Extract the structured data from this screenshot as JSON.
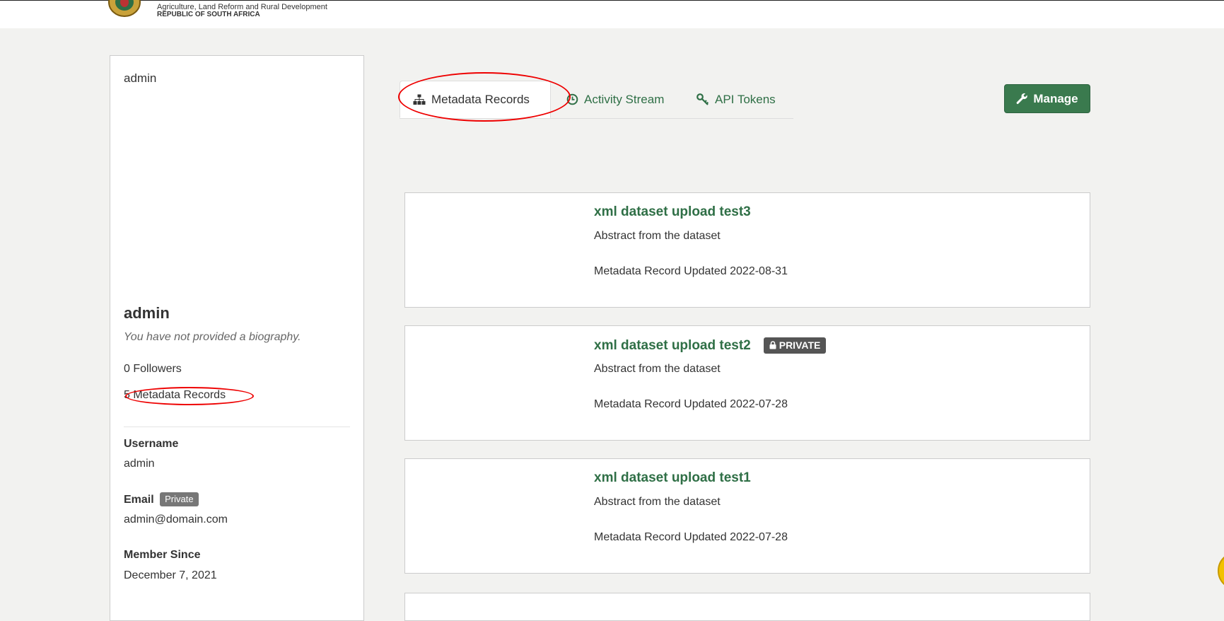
{
  "header": {
    "dept_line1": "Agriculture, Land Reform and Rural Development",
    "dept_line2": "REPUBLIC OF SOUTH AFRICA"
  },
  "sidebar": {
    "top_name": "admin",
    "heading": "admin",
    "bio": "You have not provided a biography.",
    "followers": "0 Followers",
    "records_count": "5 Metadata Records",
    "username_label": "Username",
    "username_value": "admin",
    "email_label": "Email",
    "email_badge": "Private",
    "email_value": "admin@domain.com",
    "member_since_label": "Member Since",
    "member_since_value": "December 7, 2021"
  },
  "tabs": [
    {
      "label": "Metadata Records",
      "icon": "sitemap-icon",
      "active": true
    },
    {
      "label": "Activity Stream",
      "icon": "clock-icon",
      "active": false
    },
    {
      "label": "API Tokens",
      "icon": "key-icon",
      "active": false
    }
  ],
  "manage_button": {
    "label": "Manage",
    "icon": "wrench-icon"
  },
  "datasets": [
    {
      "title": "xml dataset upload test3",
      "private": false,
      "abstract": "Abstract from the dataset",
      "updated": "Metadata Record Updated 2022-08-31"
    },
    {
      "title": "xml dataset upload test2",
      "private": true,
      "private_label": "PRIVATE",
      "abstract": "Abstract from the dataset",
      "updated": "Metadata Record Updated 2022-07-28"
    },
    {
      "title": "xml dataset upload test1",
      "private": false,
      "abstract": "Abstract from the dataset",
      "updated": "Metadata Record Updated 2022-07-28"
    }
  ],
  "colors": {
    "brand_green": "#2f6f46",
    "manage_button": "#3a7a4e",
    "annotation_red": "#e00000",
    "page_bg": "#f2f2f0"
  }
}
